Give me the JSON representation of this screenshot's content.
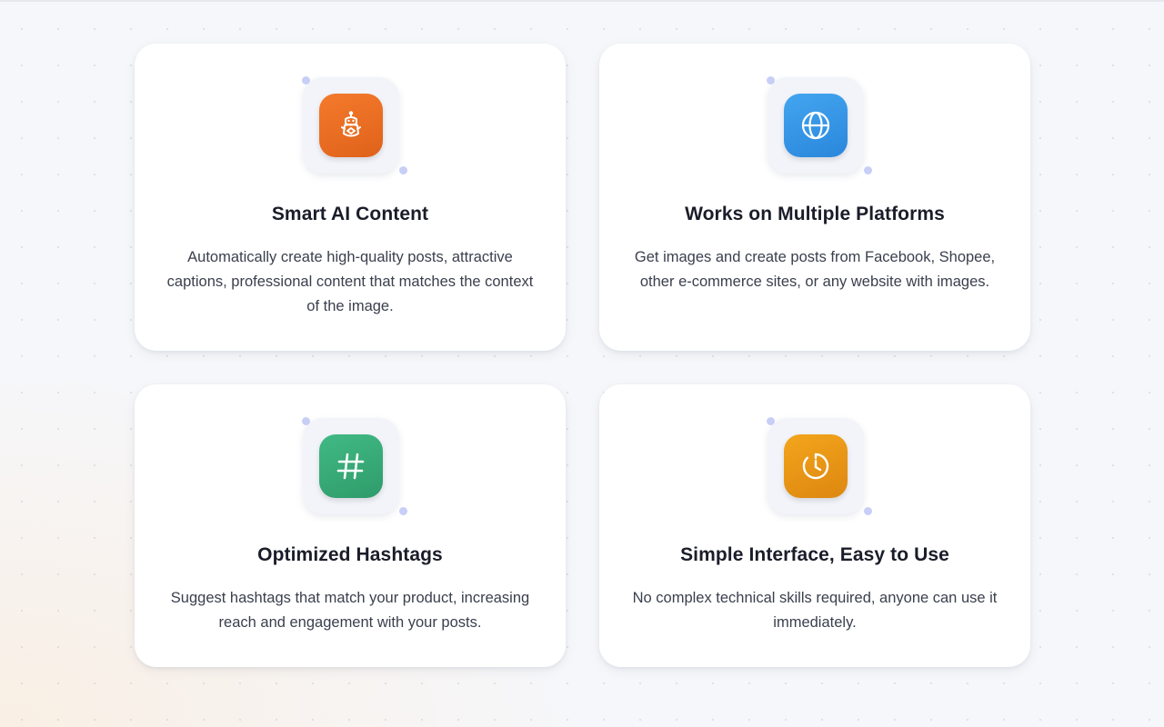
{
  "features": [
    {
      "icon": "ai-robot-icon",
      "color": "#ee6f22",
      "title": "Smart AI Content",
      "description": "Automatically create high-quality posts, attractive captions, professional content that matches the context of the image."
    },
    {
      "icon": "globe-icon",
      "color": "#3698e6",
      "title": "Works on Multiple Platforms",
      "description": "Get images and create posts from Facebook, Shopee, other e-commerce sites, or any website with images."
    },
    {
      "icon": "hashtag-icon",
      "color": "#38ab77",
      "title": "Optimized Hashtags",
      "description": "Suggest hashtags that match your product, increasing reach and engagement with your posts."
    },
    {
      "icon": "timer-icon",
      "color": "#ea9716",
      "title": "Simple Interface, Easy to Use",
      "description": "No complex technical skills required, anyone can use it immediately."
    }
  ]
}
